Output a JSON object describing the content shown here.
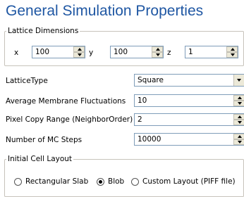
{
  "title": "General Simulation Properties",
  "lattice": {
    "legend": "Lattice Dimensions",
    "x_label": "x",
    "x_value": "100",
    "y_label": "y",
    "y_value": "100",
    "z_label": "z",
    "z_value": "1"
  },
  "properties": {
    "lattice_type_label": "LatticeType",
    "lattice_type_value": "Square",
    "membrane_label": "Average Membrane Fluctuations",
    "membrane_value": "10",
    "pixel_copy_label": "Pixel Copy Range (NeighborOrder)",
    "pixel_copy_value": "2",
    "mc_steps_label": "Number of MC Steps",
    "mc_steps_value": "10000"
  },
  "layout": {
    "legend": "Initial Cell Layout",
    "options": [
      {
        "label": "Rectangular Slab",
        "checked": false
      },
      {
        "label": "Blob",
        "checked": true
      },
      {
        "label": "Custom Layout (PIFF file)",
        "checked": false
      }
    ]
  }
}
